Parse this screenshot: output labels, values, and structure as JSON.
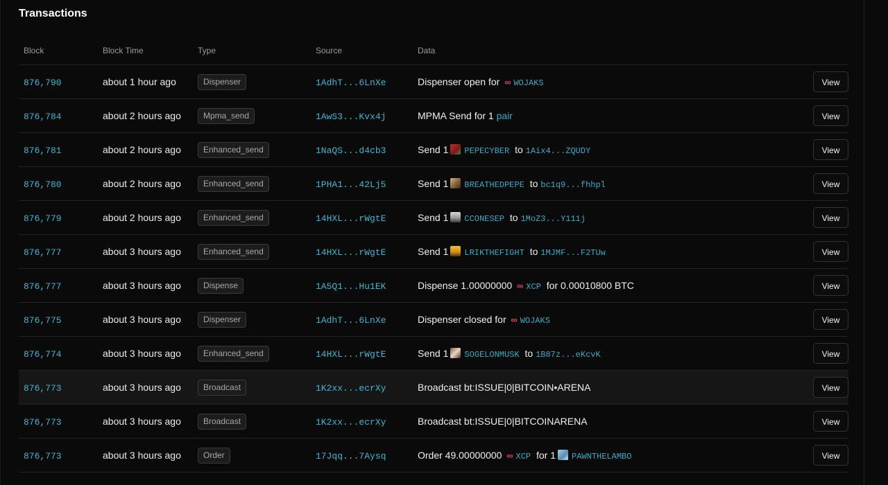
{
  "section_title": "Transactions",
  "columns": [
    "Block",
    "Block Time",
    "Type",
    "Source",
    "Data",
    ""
  ],
  "view_label": "View",
  "rows": [
    {
      "block": "876,790",
      "time": "about 1 hour ago",
      "type": "Dispenser",
      "source": "1AdhT...6LnXe",
      "d1": "Dispenser open for",
      "asset": "WOJAKS"
    },
    {
      "block": "876,784",
      "time": "about 2 hours ago",
      "type": "Mpma_send",
      "source": "1AwS3...Kvx4j",
      "d1": "MPMA Send for 1",
      "link": "pair"
    },
    {
      "block": "876,781",
      "time": "about 2 hours ago",
      "type": "Enhanced_send",
      "source": "1NaQS...d4cb3",
      "d1": "Send 1",
      "asset": "PEPECYBER",
      "d2": "to",
      "addr": "1Aix4...ZQUDY"
    },
    {
      "block": "876,780",
      "time": "about 2 hours ago",
      "type": "Enhanced_send",
      "source": "1PHA1...42Lj5",
      "d1": "Send 1",
      "asset": "BREATHEDPEPE",
      "d2": "to",
      "addr": "bc1q9...fhhpl"
    },
    {
      "block": "876,779",
      "time": "about 2 hours ago",
      "type": "Enhanced_send",
      "source": "14HXL...rWgtE",
      "d1": "Send 1",
      "asset": "CCONESEP",
      "d2": "to",
      "addr": "1MoZ3...Y111j"
    },
    {
      "block": "876,777",
      "time": "about 3 hours ago",
      "type": "Enhanced_send",
      "source": "14HXL...rWgtE",
      "d1": "Send 1",
      "asset": "LRIKTHEFIGHT",
      "d2": "to",
      "addr": "1MJMF...F2TUw"
    },
    {
      "block": "876,777",
      "time": "about 3 hours ago",
      "type": "Dispense",
      "source": "1A5Q1...Hu1EK",
      "d1": "Dispense 1.00000000",
      "asset": "XCP",
      "d2": "for 0.00010800 BTC"
    },
    {
      "block": "876,775",
      "time": "about 3 hours ago",
      "type": "Dispenser",
      "source": "1AdhT...6LnXe",
      "d1": "Dispenser closed for",
      "asset": "WOJAKS"
    },
    {
      "block": "876,774",
      "time": "about 3 hours ago",
      "type": "Enhanced_send",
      "source": "14HXL...rWgtE",
      "d1": "Send 1",
      "asset": "SOGELONMUSK",
      "d2": "to",
      "addr": "1B87z...eKcvK"
    },
    {
      "block": "876,773",
      "time": "about 3 hours ago",
      "type": "Broadcast",
      "source": "1K2xx...ecrXy",
      "d1": "Broadcast bt:ISSUE|0|BITCOIN•ARENA"
    },
    {
      "block": "876,773",
      "time": "about 3 hours ago",
      "type": "Broadcast",
      "source": "1K2xx...ecrXy",
      "d1": "Broadcast bt:ISSUE|0|BITCOINARENA"
    },
    {
      "block": "876,773",
      "time": "about 3 hours ago",
      "type": "Order",
      "source": "17Jqq...7Aysq",
      "d1": "Order 49.00000000",
      "asset": "XCP",
      "d2": "for 1",
      "asset2": "PAWNTHELAMBO"
    }
  ],
  "colors": {
    "link": "#45b4d0",
    "xcp": "#e0425b",
    "bg": "#0a0a0a"
  }
}
